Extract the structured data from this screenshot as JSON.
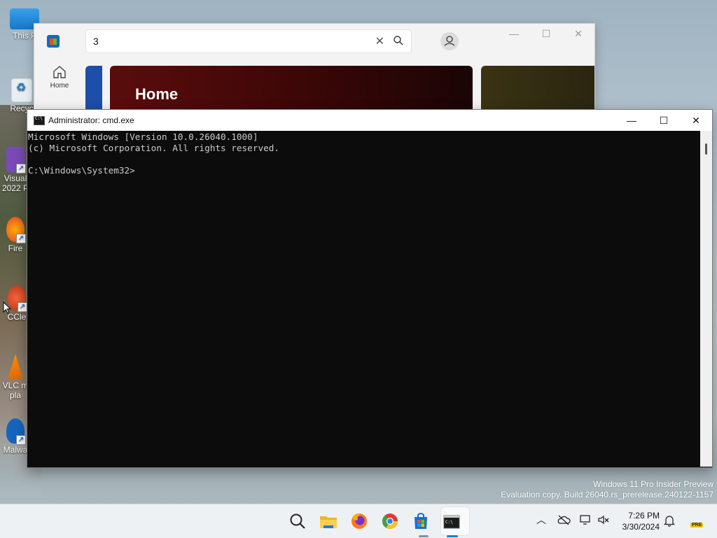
{
  "desktop": {
    "icons": [
      {
        "label": "This P",
        "name": "desktop-icon-this-pc"
      },
      {
        "label": "Recyc",
        "name": "desktop-icon-recycle-bin"
      },
      {
        "label": "Visual\n2022 P",
        "name": "desktop-icon-visual-studio"
      },
      {
        "label": "Fire",
        "name": "desktop-icon-firefox"
      },
      {
        "label": "CCle",
        "name": "desktop-icon-ccleaner"
      },
      {
        "label": "VLC m\npla",
        "name": "desktop-icon-vlc"
      },
      {
        "label": "Malwa",
        "name": "desktop-icon-malwarebytes"
      }
    ]
  },
  "store": {
    "search_value": "3",
    "nav_home_label": "Home",
    "banner_title": "Home",
    "colors": {
      "accent": "#0f6cbd"
    }
  },
  "cmd": {
    "title": "Administrator: cmd.exe",
    "console_lines": [
      "Microsoft Windows [Version 10.0.26040.1000]",
      "(c) Microsoft Corporation. All rights reserved.",
      "",
      "C:\\Windows\\System32>"
    ],
    "min_glyph": "—",
    "max_glyph": "☐",
    "close_glyph": "✕"
  },
  "watermark": {
    "line1": "Windows 11 Pro Insider Preview",
    "line2": "Evaluation copy. Build 26040.rs_prerelease.240122-1157"
  },
  "taskbar": {
    "apps": [
      "search-icon",
      "file-explorer-icon",
      "firefox-icon",
      "chrome-icon",
      "store-icon",
      "terminal-icon"
    ],
    "time": "7:26 PM",
    "date": "3/30/2024",
    "tray_badge": "PRE"
  }
}
